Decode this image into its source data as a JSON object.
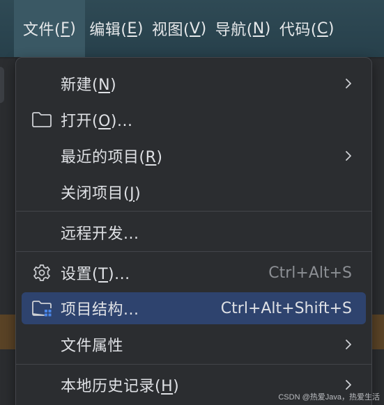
{
  "menubar": {
    "items": [
      {
        "label": "文件(",
        "mnemonic": "F",
        "suffix": ")"
      },
      {
        "label": "编辑(",
        "mnemonic": "E",
        "suffix": ")"
      },
      {
        "label": "视图(",
        "mnemonic": "V",
        "suffix": ")"
      },
      {
        "label": "导航(",
        "mnemonic": "N",
        "suffix": ")"
      },
      {
        "label": "代码(",
        "mnemonic": "C",
        "suffix": ")"
      }
    ]
  },
  "menu": {
    "items": [
      {
        "label": "新建(",
        "mnemonic": "N",
        "suffix": ")",
        "icon": "none",
        "submenu": "chevron-right-icon"
      },
      {
        "label": "打开(",
        "mnemonic": "O",
        "suffix": ")...",
        "icon": "folder-icon"
      },
      {
        "label": "最近的项目(",
        "mnemonic": "R",
        "suffix": ")",
        "submenu": "chevron-right-icon"
      },
      {
        "label": "关闭项目(",
        "mnemonic": "J",
        "suffix": ")"
      },
      {
        "label": "远程开发..."
      },
      {
        "label": "设置(",
        "mnemonic": "T",
        "suffix": ")...",
        "icon": "gear-icon",
        "shortcut": "Ctrl+Alt+S"
      },
      {
        "label": "项目结构...",
        "icon": "project-structure-icon",
        "shortcut": "Ctrl+Alt+Shift+S",
        "selected": true
      },
      {
        "label": "文件属性",
        "submenu": "chevron-right-icon"
      },
      {
        "label": "本地历史记录(",
        "mnemonic": "H",
        "suffix": ")",
        "submenu": "chevron-right-icon"
      }
    ]
  },
  "colors": {
    "menubar_bg": "#2f4a55",
    "menu_bg": "#2b2d30",
    "selected_bg": "#2e436e",
    "text": "#dfe1e5",
    "shortcut_text": "#8c8f94",
    "icon_accent": "#4a86e8"
  },
  "watermark": "CSDN @热爱Java，热爱生活"
}
